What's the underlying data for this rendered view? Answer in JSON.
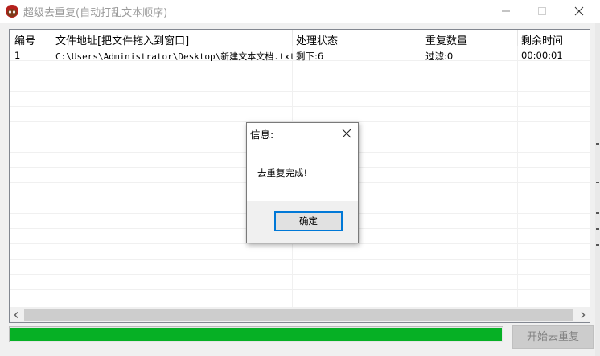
{
  "window": {
    "title": "超级去重复(自动打乱文本顺序)",
    "icon": "cat-face-icon",
    "controls": {
      "minimize": "minimize-icon",
      "maximize": "maximize-icon",
      "close": "close-icon"
    }
  },
  "list": {
    "columns": [
      "编号",
      "文件地址[把文件拖入到窗口]",
      "处理状态",
      "重复数量",
      "剩余时间"
    ],
    "rows": [
      {
        "id": "1",
        "path": "C:\\Users\\Administrator\\Desktop\\新建文本文档.txt",
        "status": "剩下:6",
        "dup": "过滤:0",
        "time": "00:00:01"
      }
    ]
  },
  "progress": {
    "value_percent": 100,
    "color": "#06b025"
  },
  "start_button": {
    "label": "开始去重复",
    "enabled": false
  },
  "dialog": {
    "title": "信息:",
    "message": "去重复完成!",
    "ok_label": "确定",
    "accent": "#0078d7"
  }
}
